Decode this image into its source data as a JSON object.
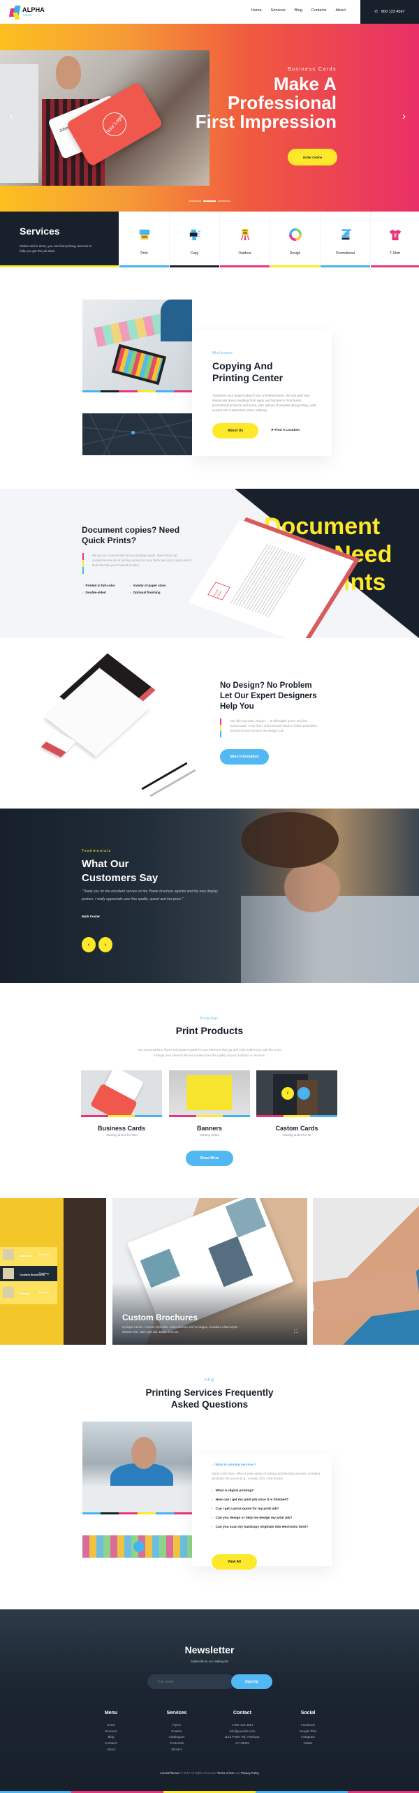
{
  "colors": {
    "cyan": "#45b3f0",
    "magenta": "#e8347b",
    "yellow": "#fde92a",
    "dark": "#17202b"
  },
  "header": {
    "logo": {
      "name": "ALPHA",
      "tagline": "COLOR"
    },
    "nav": [
      "Home",
      "Services",
      "Blog",
      "Contacts",
      "About"
    ],
    "phone": "800 123 4567"
  },
  "hero": {
    "subtitle": "Business Cards",
    "title_lines": [
      "Make A",
      "Professional",
      "First Impression"
    ],
    "card_name": "John Doe",
    "card_logo": "Your Logo",
    "button": "Order Online",
    "slides": 3,
    "active_slide": 2
  },
  "services": {
    "title": "Services",
    "description": "Online and in store, you can find printing services to help you get the job done",
    "items": [
      {
        "label": "Print",
        "icon": "printer-icon",
        "color": "#45b3f0"
      },
      {
        "label": "Copy",
        "icon": "copier-icon",
        "color": "#17202b"
      },
      {
        "label": "Outdoor",
        "icon": "easel-sign-icon",
        "color": "#e8347b"
      },
      {
        "label": "Design",
        "icon": "color-wheel-icon",
        "color": "#fde92a"
      },
      {
        "label": "Promotional",
        "icon": "flyers-icon",
        "color": "#45b3f0"
      },
      {
        "label": "T-Shirt",
        "icon": "tshirt-icon",
        "color": "#e8347b"
      }
    ]
  },
  "welcome": {
    "eyebrow": "Welcome",
    "title_lines": [
      "Copying And",
      "Printing Center"
    ],
    "text": "Transform your project (idea!?) into a finished piece. We can print and design just about anything from signs and banners to brochures, promotional products and forms, with options of variable data printing, web-to-print and customized online ordering.",
    "button": "About Us",
    "link": "Find A Location"
  },
  "documents": {
    "title_lines": [
      "Document copies? Need",
      "Quick Prints?"
    ],
    "text": "We got you covered with all your printing needs. Select from our comprehensive list of printing options for your B&W and color copies which best describe your finished product.",
    "features": [
      "Printed in full-color",
      "Variety of paper sizes",
      "Double-sided",
      "Optional finishing"
    ],
    "background_text": [
      "Document",
      "? Need",
      "prints"
    ],
    "paper_logo": "YOUR LOGO"
  },
  "design": {
    "title_lines": [
      "No Design? No Problem",
      "Let Our Expert Designers",
      "Help You"
    ],
    "text": "We offer top class designs — at affordable prices and fast turnarounds. From flyers and business cards to folded pamphlets, brochures and lot more! We design it all.",
    "button": "More Information"
  },
  "testimonials": {
    "eyebrow": "Testimonials",
    "title_lines": [
      "What Our",
      "Customers Say"
    ],
    "quote": "\"Thank you for the excellent service on the Power brochure reprints and the new display posters. I really appreciate your fine quality, speed and low price.\"",
    "author": "Mark Foster",
    "prev": "‹",
    "next": "›"
  },
  "products": {
    "eyebrow": "Popular",
    "title": "Print Products",
    "text_lines": [
      "Your presentations, flyers and posters speak for you wherever they go and color makes you look like a pro.",
      "It brings your ideas to life and underscores the quality of your products or services."
    ],
    "items": [
      {
        "name": "Business Cards",
        "price": "Starting at $14 for 500"
      },
      {
        "name": "Banners",
        "price": "Starting at $11"
      },
      {
        "name": "Castom Cards",
        "price": "Starting at $19 for 25"
      }
    ],
    "hover_info": "i",
    "button": "Show More"
  },
  "gallery": {
    "menu": [
      {
        "category": "Printing",
        "name": "Banners"
      },
      {
        "category": "Printing",
        "name": "Custom Brochures",
        "active": true
      },
      {
        "category": "Printing",
        "name": "Posters"
      }
    ],
    "featured": {
      "title": "Custom Brochures",
      "text": "Quisque rutrum. Aenean imperdiet. Etiam ultricies nisi vel augue. Curabitur ullamcorper ultricies nisi. Nam eget dui. Etiam rhoncus."
    }
  },
  "faq": {
    "eyebrow": "FAQ",
    "title_lines": [
      "Printing Services Frequently",
      "Asked Questions"
    ],
    "open_question": "What is printing services?",
    "open_answer": "Alpha Color Store offers a wide variety of printing and finishing services, including electronic file access (e.g., e-mails, CDs, USB drives)",
    "questions": [
      "What is digital printing?",
      "How can I get my print job once it is finished?",
      "Can I get a price quote for my print job?",
      "Can you design or help me design my print job?",
      "Can you scan my hardcopy originals into electronic form?"
    ],
    "button": "View All"
  },
  "newsletter": {
    "title": "Newsletter",
    "subtitle": "Subscribe to our mailing list",
    "placeholder": "Your email",
    "button": "Sign Up"
  },
  "footer": {
    "columns": [
      {
        "title": "Menu",
        "items": [
          "Home",
          "Services",
          "Blog",
          "Contacts",
          "About"
        ]
      },
      {
        "title": "Services",
        "items": [
          "Flyers",
          "Posters",
          "Catalogues",
          "Postcards",
          "Stickers"
        ]
      },
      {
        "title": "Contact",
        "items": [
          "1 800 123 4567",
          "info@yoursite.com",
          "1122 Potter Rd, Antelope,",
          "CA 32802"
        ]
      },
      {
        "title": "Social",
        "items": [
          "Facebook",
          "Google Plus",
          "Instagram",
          "Twitter"
        ]
      }
    ],
    "copyright": {
      "brand": "AncoraThemes",
      "text": " © 2017 All Rights Reserved ",
      "terms": "Terms of Use",
      "and": " and ",
      "privacy": "Privacy Policy"
    }
  }
}
